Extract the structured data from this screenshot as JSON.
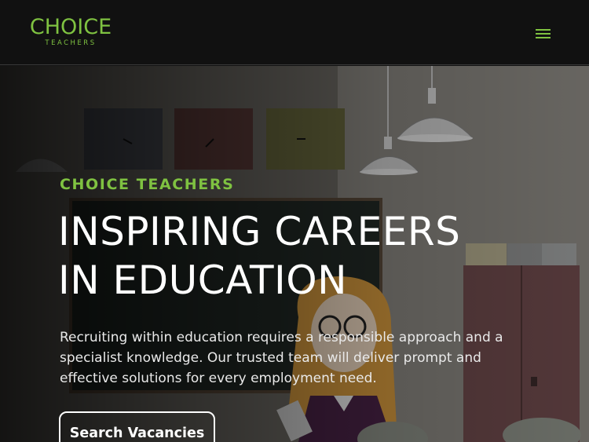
{
  "header": {
    "logo_main": "CHOICE",
    "logo_sub": "TEACHERS",
    "menu_label": "Menu"
  },
  "hero": {
    "eyebrow": "CHOICE TEACHERS",
    "headline_line1": "INSPIRING CAREERS",
    "headline_line2": "IN EDUCATION",
    "lede": "Recruiting within education requires a responsible approach and a specialist knowledge. Our trusted team will deliver prompt and effective solutions for every employment need.",
    "cta_label": "Search Vacancies"
  },
  "colors": {
    "brand_green": "#7fc241",
    "header_bg": "#111111",
    "text_white": "#ffffff"
  },
  "icons": {
    "menu": "hamburger-menu-icon"
  }
}
